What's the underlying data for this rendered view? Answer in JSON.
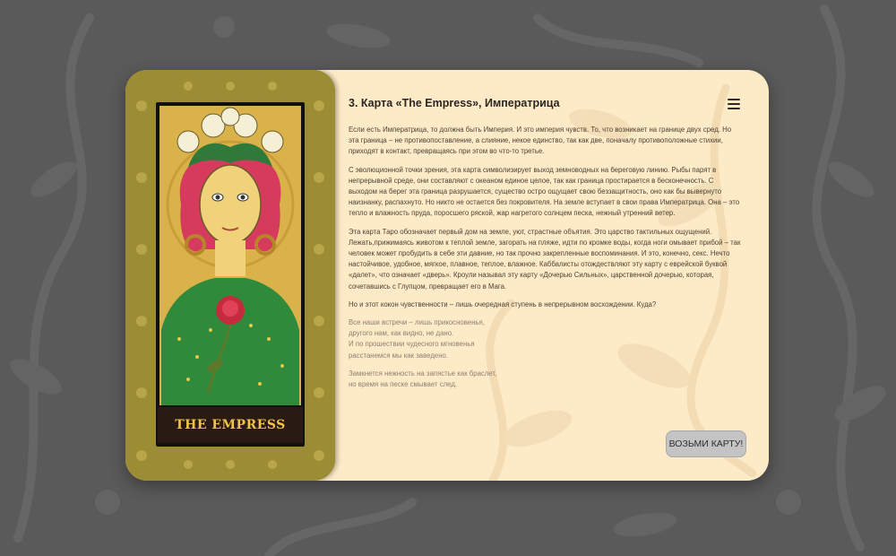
{
  "card": {
    "caption": "THE EMPRESS"
  },
  "content": {
    "title": "3. Карта «The Empress», Императрица",
    "paragraphs": [
      "Если есть Императрица, то должна быть Империя. И это империя чувств. То, что возникает на границе двух сред. Но эта граница – не противопоставление, а слияние, некое единство, так как две, поначалу противоположные стихии, приходят в контакт, превращаясь при этом во что-то третье.",
      "С эволюционной точки зрения, эта карта символизирует выход земноводных на береговую линию. Рыбы парят в непрерывной среде, они составляют с океаном единое целое, так как граница простирается в бесконечность. С выходом на берег эта граница разрушается, существо остро ощущает свою беззащитность, оно как бы вывернуто наизнанку, распахнуто. Но никто не остается без покровителя. На земле вступает в свои права Императрица. Она – это тепло и влажность пруда, поросшего ряской, жар нагретого солнцем песка, нежный утренний ветер.",
      "Эта карта Таро обозначает первый дом на земле, уют, страстные объятия. Это царство тактильных ощущений. Лежать,прижимаясь животом к теплой земле, загорать на пляже, идти по кромке воды, когда ноги омывает прибой – так человек может пробудить в себе эти давние, но так прочно закрепленные воспоминания. И это, конечно, секс. Нечто настойчивое, удобное, мягкое, плавное, теплое, влажное. Каббалисты отождествляют эту карту с еврейской буквой «далет», что означает «дверь». Кроули называл эту карту «Дочерью Сильных», царственной дочерью, которая, сочетавшись с Глупцом, превращает его в Мага.",
      "Но и этот кокон чувственности – лишь очередная ступень в непрерывном восхождении. Куда?"
    ],
    "poem1": [
      "Все наши встречи – лишь прикосновенья,",
      "другого нам, как видно, не дано.",
      "И по прошествии чудесного мгновенья",
      "расстанемся мы как заведено."
    ],
    "poem2": [
      "Замкнется нежность на запястье как браслет,",
      "но время на песке смывает след."
    ]
  },
  "actions": {
    "take_card": "ВОЗЬМИ КАРТУ!"
  },
  "icons": {
    "menu": "hamburger-menu-icon"
  },
  "colors": {
    "page_bg": "#5a5a5a",
    "panel_bg": "#fdebc8",
    "card_border": "#9a8a32",
    "caption_text": "#f1c34a",
    "button_bg": "#c4c4c4"
  }
}
